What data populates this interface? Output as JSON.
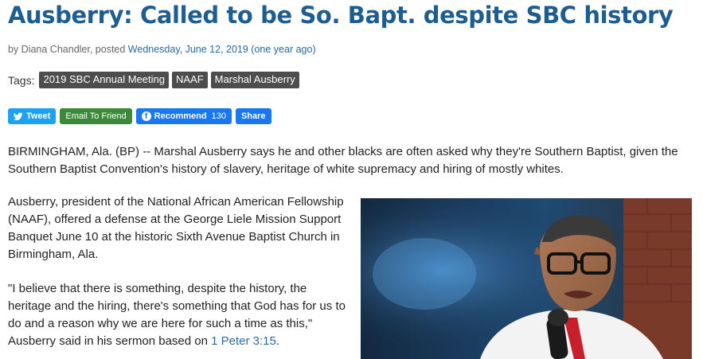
{
  "article": {
    "headline": "Ausberry: Called to be So. Bapt. despite SBC history",
    "byline_prefix": "by Diana Chandler, posted ",
    "date": "Wednesday, June 12, 2019 (one year ago)",
    "tags_label": "Tags:",
    "tags": [
      "2019 SBC Annual Meeting",
      "NAAF",
      "Marshal Ausberry"
    ],
    "share": {
      "tweet": "Tweet",
      "email": "Email To Friend",
      "recommend": "Recommend",
      "recommend_count": "130",
      "share": "Share"
    },
    "p1": "BIRMINGHAM, Ala. (BP) -- Marshal Ausberry says he and other blacks are often asked why they're Southern Baptist, given the Southern Baptist Convention's history of slavery, heritage of white supremacy and hiring of mostly whites.",
    "p2": "Ausberry, president of the National African American Fellowship (NAAF), offered a defense at the George Liele Mission Support Banquet June 10 at the historic Sixth Avenue Baptist Church in Birmingham, Ala.",
    "p3_text": "\"I believe that there is something, despite the history, the heritage and the hiring, there's something that God has for us to do and a reason why we are here for such a time as this,\" Ausberry said in his sermon based on ",
    "p3_link": "1 Peter 3:15",
    "p3_end": "."
  },
  "icons": {
    "twitter": "twitter-bird-icon",
    "facebook": "facebook-icon"
  }
}
